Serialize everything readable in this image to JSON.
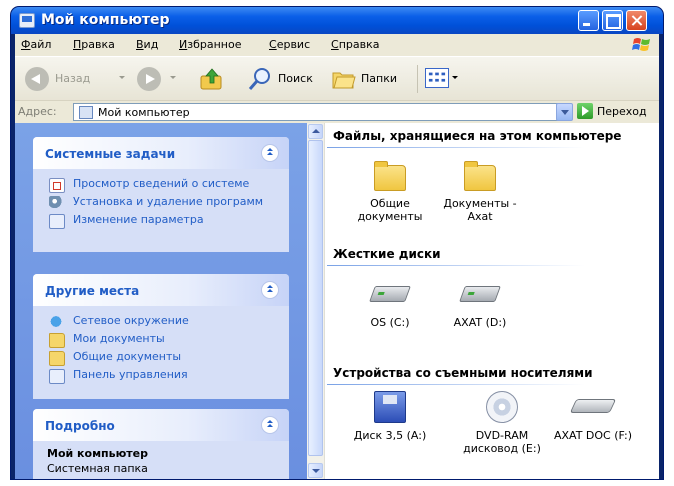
{
  "window": {
    "title": "Мой компьютер"
  },
  "menu": {
    "items": [
      "Файл",
      "Правка",
      "Вид",
      "Избранное",
      "Сервис",
      "Справка"
    ]
  },
  "toolbar": {
    "back_label": "Назад",
    "search_label": "Поиск",
    "folders_label": "Папки"
  },
  "address": {
    "label": "Адрес:",
    "value": "Мой компьютер",
    "go_label": "Переход"
  },
  "taskpane": {
    "system_tasks": {
      "title": "Системные задачи",
      "items": [
        "Просмотр сведений о системе",
        "Установка и удаление программ",
        "Изменение параметра"
      ]
    },
    "other_places": {
      "title": "Другие места",
      "items": [
        "Сетевое окружение",
        "Мои документы",
        "Общие документы",
        "Панель управления"
      ]
    },
    "details": {
      "title": "Подробно",
      "name": "Мой компьютер",
      "type": "Системная папка"
    }
  },
  "content": {
    "groups": [
      {
        "title": "Файлы, хранящиеся на этом компьютере",
        "items": [
          "Общие документы",
          "Документы - Axat"
        ]
      },
      {
        "title": "Жесткие диски",
        "items": [
          "OS (C:)",
          "AXAT (D:)"
        ]
      },
      {
        "title": "Устройства со съемными носителями",
        "items": [
          "Диск 3,5 (A:)",
          "DVD-RAM дисковод (E:)",
          "AXAT DOC (F:)"
        ]
      }
    ]
  },
  "colors": {
    "titlebar": "#0a5fe8",
    "taskpane_bg": "#7ba2e7",
    "task_link": "#215dc6"
  }
}
